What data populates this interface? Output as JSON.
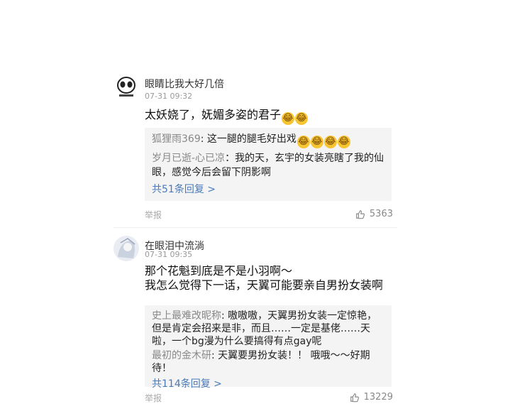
{
  "comments": [
    {
      "username": "眼睛比我大好几倍",
      "time": "07-31 09:32",
      "text": "太妖娆了，妩媚多姿的君子",
      "emoji_count": 2,
      "replies": [
        {
          "name": "狐狸雨369",
          "text": "这一腿的腿毛好出戏"
        },
        {
          "name": "岁月已逝-心已凉",
          "text": "我的天，玄宇的女装亮瞎了我的仙眼，感觉今后会留下阴影啊"
        }
      ],
      "more": "共51条回复 >",
      "report": "举报",
      "likes": "5363"
    },
    {
      "username": "在眼泪中流淌",
      "time": "07-31 09:35",
      "text_line1": "那个花魁到底是不是小羽啊～",
      "text_line2": "我怎么觉得下一话，天翼可能要亲自男扮女装啊",
      "replies": [
        {
          "name": "史上最难改昵称",
          "text": "嗷嗷嗷，天翼男扮女装一定惊艳，但是肯定会招来是非，而且……一定是基佬……天啦，一个bg漫为什么要搞得有点gay呢"
        },
        {
          "name": "最初的金木研",
          "text": "天翼要男扮女装！！ 哦哦～～好期待！"
        }
      ],
      "more": "共114条回复 >",
      "report": "举报",
      "likes": "13229"
    }
  ],
  "icons": {
    "emoji": "laughing-tears-icon",
    "like": "thumb-up-icon"
  }
}
